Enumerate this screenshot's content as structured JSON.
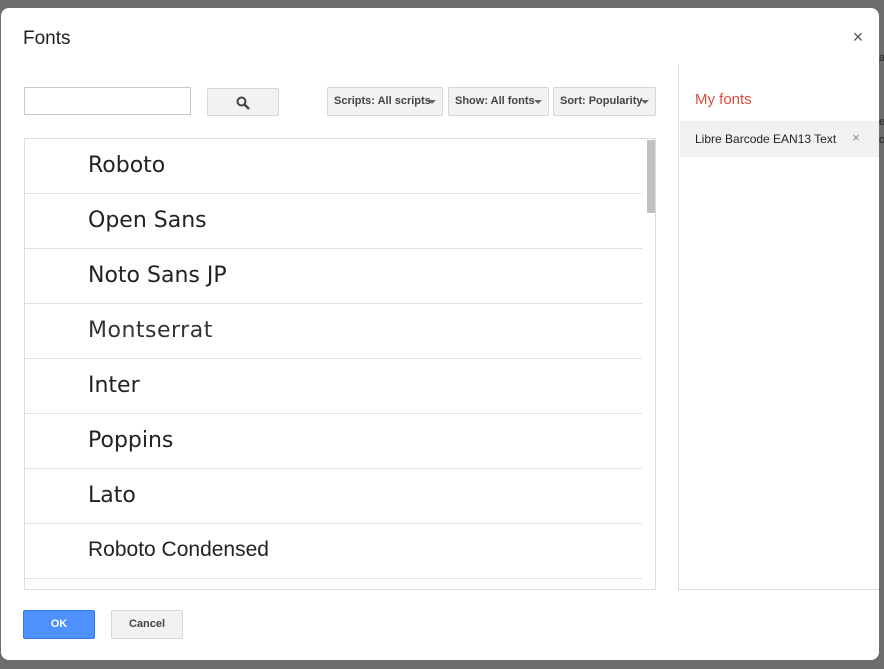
{
  "dialog": {
    "title": "Fonts",
    "close_label": "×"
  },
  "toolbar": {
    "search_value": "",
    "search_placeholder": "",
    "scripts_label": "Scripts: All scripts",
    "show_label": "Show: All fonts",
    "sort_label": "Sort: Popularity"
  },
  "font_list": {
    "items": [
      {
        "label": "Roboto"
      },
      {
        "label": "Open Sans"
      },
      {
        "label": "Noto Sans JP"
      },
      {
        "label": "Montserrat"
      },
      {
        "label": "Inter"
      },
      {
        "label": "Poppins"
      },
      {
        "label": "Lato"
      },
      {
        "label": "Roboto Condensed"
      }
    ]
  },
  "my_fonts": {
    "title": "My fonts",
    "items": [
      {
        "label": "Libre Barcode EAN13 Text",
        "remove_label": "×"
      }
    ]
  },
  "footer": {
    "ok_label": "OK",
    "cancel_label": "Cancel"
  },
  "colors": {
    "accent_blue": "#4d90fe",
    "my_fonts_red": "#dd4b39",
    "overlay": "#6e6e6e"
  },
  "icons": {
    "search": "search-icon",
    "dropdown": "caret-down-icon",
    "close": "close-icon",
    "remove": "remove-icon"
  }
}
